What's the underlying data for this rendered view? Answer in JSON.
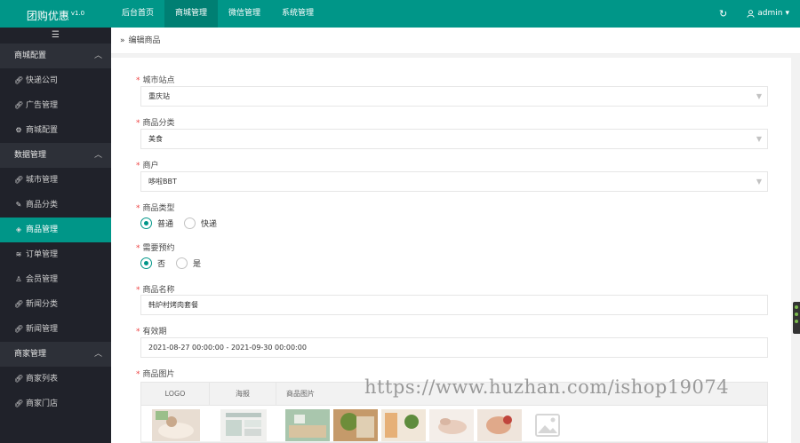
{
  "brand": {
    "name": "团购优惠",
    "version": "v1.0"
  },
  "topnav": [
    {
      "label": "后台首页",
      "active": false
    },
    {
      "label": "商城管理",
      "active": true
    },
    {
      "label": "微信管理",
      "active": false
    },
    {
      "label": "系统管理",
      "active": false
    }
  ],
  "topright": {
    "refresh_icon": "refresh-icon",
    "user_icon": "user-icon",
    "username": "admin",
    "caret": "▾"
  },
  "sidebar": {
    "toggle_icon": "menu-icon",
    "groups": [
      {
        "label": "商城配置",
        "items": [
          {
            "label": "快递公司",
            "icon": "link-icon"
          },
          {
            "label": "广告管理",
            "icon": "link-icon"
          },
          {
            "label": "商城配置",
            "icon": "gear-icon"
          }
        ]
      },
      {
        "label": "数据管理",
        "items": [
          {
            "label": "城市管理",
            "icon": "link-icon"
          },
          {
            "label": "商品分类",
            "icon": "edit-icon"
          },
          {
            "label": "商品管理",
            "icon": "box-icon",
            "active": true
          },
          {
            "label": "订单管理",
            "icon": "stack-icon"
          },
          {
            "label": "会员管理",
            "icon": "user-icon"
          },
          {
            "label": "新闻分类",
            "icon": "link-icon"
          },
          {
            "label": "新闻管理",
            "icon": "link-icon"
          }
        ]
      },
      {
        "label": "商家管理",
        "items": [
          {
            "label": "商家列表",
            "icon": "link-icon"
          },
          {
            "label": "商家门店",
            "icon": "link-icon"
          }
        ]
      }
    ]
  },
  "breadcrumb": {
    "icon": "double-chevron-icon",
    "label": "编辑商品"
  },
  "form": {
    "city": {
      "label": "城市站点",
      "value": "重庆站"
    },
    "category": {
      "label": "商品分类",
      "value": "美食"
    },
    "merchant": {
      "label": "商户",
      "value": "哆啦BBT"
    },
    "goods_type": {
      "label": "商品类型",
      "options": [
        "普通",
        "快递"
      ],
      "selected": 0
    },
    "reserve": {
      "label": "需要预约",
      "options": [
        "否",
        "是"
      ],
      "selected": 0
    },
    "name": {
      "label": "商品名称",
      "value": "韩炉村烤肉套餐"
    },
    "period": {
      "label": "有效期",
      "value": "2021-08-27 00:00:00 - 2021-09-30 00:00:00"
    },
    "images": {
      "label": "商品图片",
      "columns": [
        "LOGO",
        "海报",
        "商品图片"
      ]
    }
  },
  "watermark": "https://www.huzhan.com/ishop19074",
  "colors": {
    "accent": "#009688",
    "sidebar_bg": "#20222a",
    "required": "#ee4444"
  }
}
